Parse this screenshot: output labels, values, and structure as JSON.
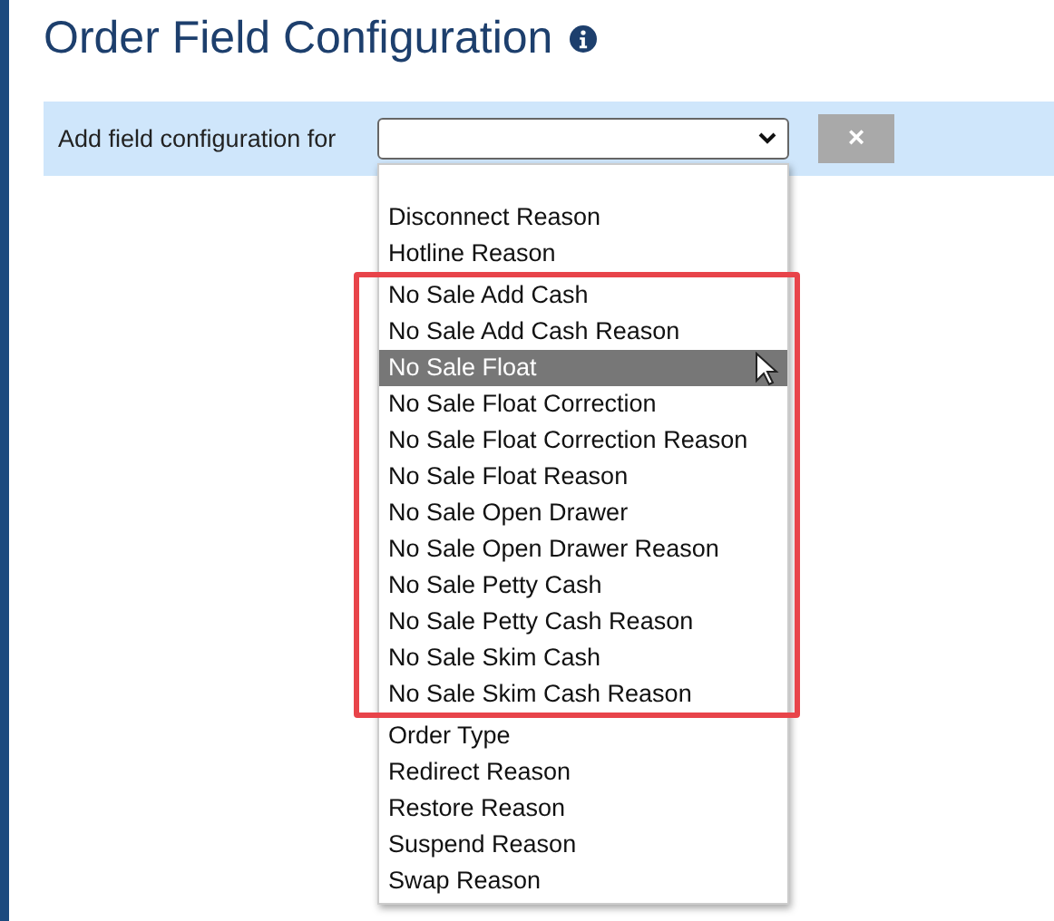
{
  "title": "Order Field Configuration",
  "toolbar": {
    "label": "Add field configuration for",
    "clear_button": "×"
  },
  "dropdown": {
    "options_before": [
      {
        "label": "Disconnect Reason",
        "selected": false
      },
      {
        "label": "Hotline Reason",
        "selected": false
      }
    ],
    "highlighted_options": [
      {
        "label": "No Sale Add Cash",
        "selected": false
      },
      {
        "label": "No Sale Add Cash Reason",
        "selected": false
      },
      {
        "label": "No Sale Float",
        "selected": true
      },
      {
        "label": "No Sale Float Correction",
        "selected": false
      },
      {
        "label": "No Sale Float Correction Reason",
        "selected": false
      },
      {
        "label": "No Sale Float Reason",
        "selected": false
      },
      {
        "label": "No Sale Open Drawer",
        "selected": false
      },
      {
        "label": "No Sale Open Drawer Reason",
        "selected": false
      },
      {
        "label": "No Sale Petty Cash",
        "selected": false
      },
      {
        "label": "No Sale Petty Cash Reason",
        "selected": false
      },
      {
        "label": "No Sale Skim Cash",
        "selected": false
      },
      {
        "label": "No Sale Skim Cash Reason",
        "selected": false
      }
    ],
    "options_after": [
      {
        "label": "Order Type",
        "selected": false
      },
      {
        "label": "Redirect Reason",
        "selected": false
      },
      {
        "label": "Restore Reason",
        "selected": false
      },
      {
        "label": "Suspend Reason",
        "selected": false
      },
      {
        "label": "Swap Reason",
        "selected": false
      }
    ]
  }
}
